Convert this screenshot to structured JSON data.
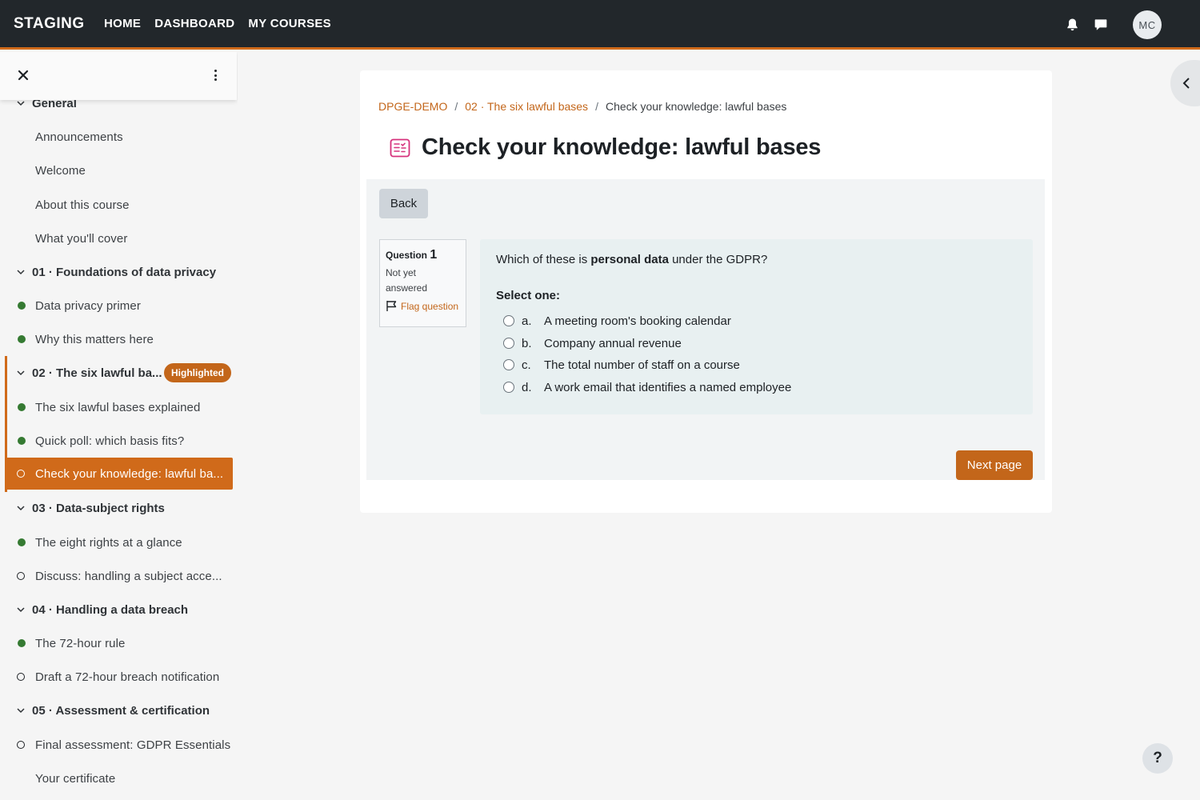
{
  "navbar": {
    "brand": "STAGING",
    "links": [
      "HOME",
      "DASHBOARD",
      "MY COURSES"
    ],
    "user_initials": "MC"
  },
  "course_index": {
    "sections": [
      {
        "title": "General",
        "items": [
          {
            "label": "Announcements",
            "status": "none"
          },
          {
            "label": "Welcome",
            "status": "none"
          },
          {
            "label": "About this course",
            "status": "none"
          },
          {
            "label": "What you'll cover",
            "status": "none"
          }
        ]
      },
      {
        "title": "01 · Foundations of data privacy",
        "items": [
          {
            "label": "Data privacy primer",
            "status": "complete"
          },
          {
            "label": "Why this matters here",
            "status": "complete"
          }
        ]
      },
      {
        "title": "02 · The six lawful ba...",
        "badge": "Highlighted",
        "items": [
          {
            "label": "The six lawful bases explained",
            "status": "complete"
          },
          {
            "label": "Quick poll: which basis fits?",
            "status": "complete"
          },
          {
            "label": "Check your knowledge: lawful ba...",
            "status": "current"
          }
        ]
      },
      {
        "title": "03 · Data-subject rights",
        "items": [
          {
            "label": "The eight rights at a glance",
            "status": "complete"
          },
          {
            "label": "Discuss: handling a subject acce...",
            "status": "incomplete"
          }
        ]
      },
      {
        "title": "04 · Handling a data breach",
        "items": [
          {
            "label": "The 72-hour rule",
            "status": "complete"
          },
          {
            "label": "Draft a 72-hour breach notification",
            "status": "incomplete"
          }
        ]
      },
      {
        "title": "05 · Assessment & certification",
        "items": [
          {
            "label": "Final assessment: GDPR Essentials",
            "status": "incomplete"
          },
          {
            "label": "Your certificate",
            "status": "none"
          }
        ]
      }
    ]
  },
  "breadcrumb": {
    "course": "DPGE-DEMO",
    "section": "02 · The six lawful bases",
    "current": "Check your knowledge: lawful bases",
    "separator": "/"
  },
  "page": {
    "title": "Check your knowledge: lawful bases"
  },
  "quiz": {
    "back_label": "Back",
    "question_label": "Question",
    "question_number": "1",
    "state": "Not yet answered",
    "flag_label": "Flag question",
    "question_before": "Which of these is ",
    "question_bold": "personal data",
    "question_after": " under the GDPR?",
    "prompt": "Select one:",
    "answers": [
      {
        "letter": "a.",
        "text": "A meeting room's booking calendar"
      },
      {
        "letter": "b.",
        "text": "Company annual revenue"
      },
      {
        "letter": "c.",
        "text": "The total number of staff on a course"
      },
      {
        "letter": "d.",
        "text": "A work email that identifies a named employee"
      }
    ],
    "next_label": "Next page"
  },
  "help": {
    "label": "?"
  },
  "colors": {
    "accent": "#c3661a",
    "navbar": "#22272b",
    "complete_dot": "#357a32"
  }
}
